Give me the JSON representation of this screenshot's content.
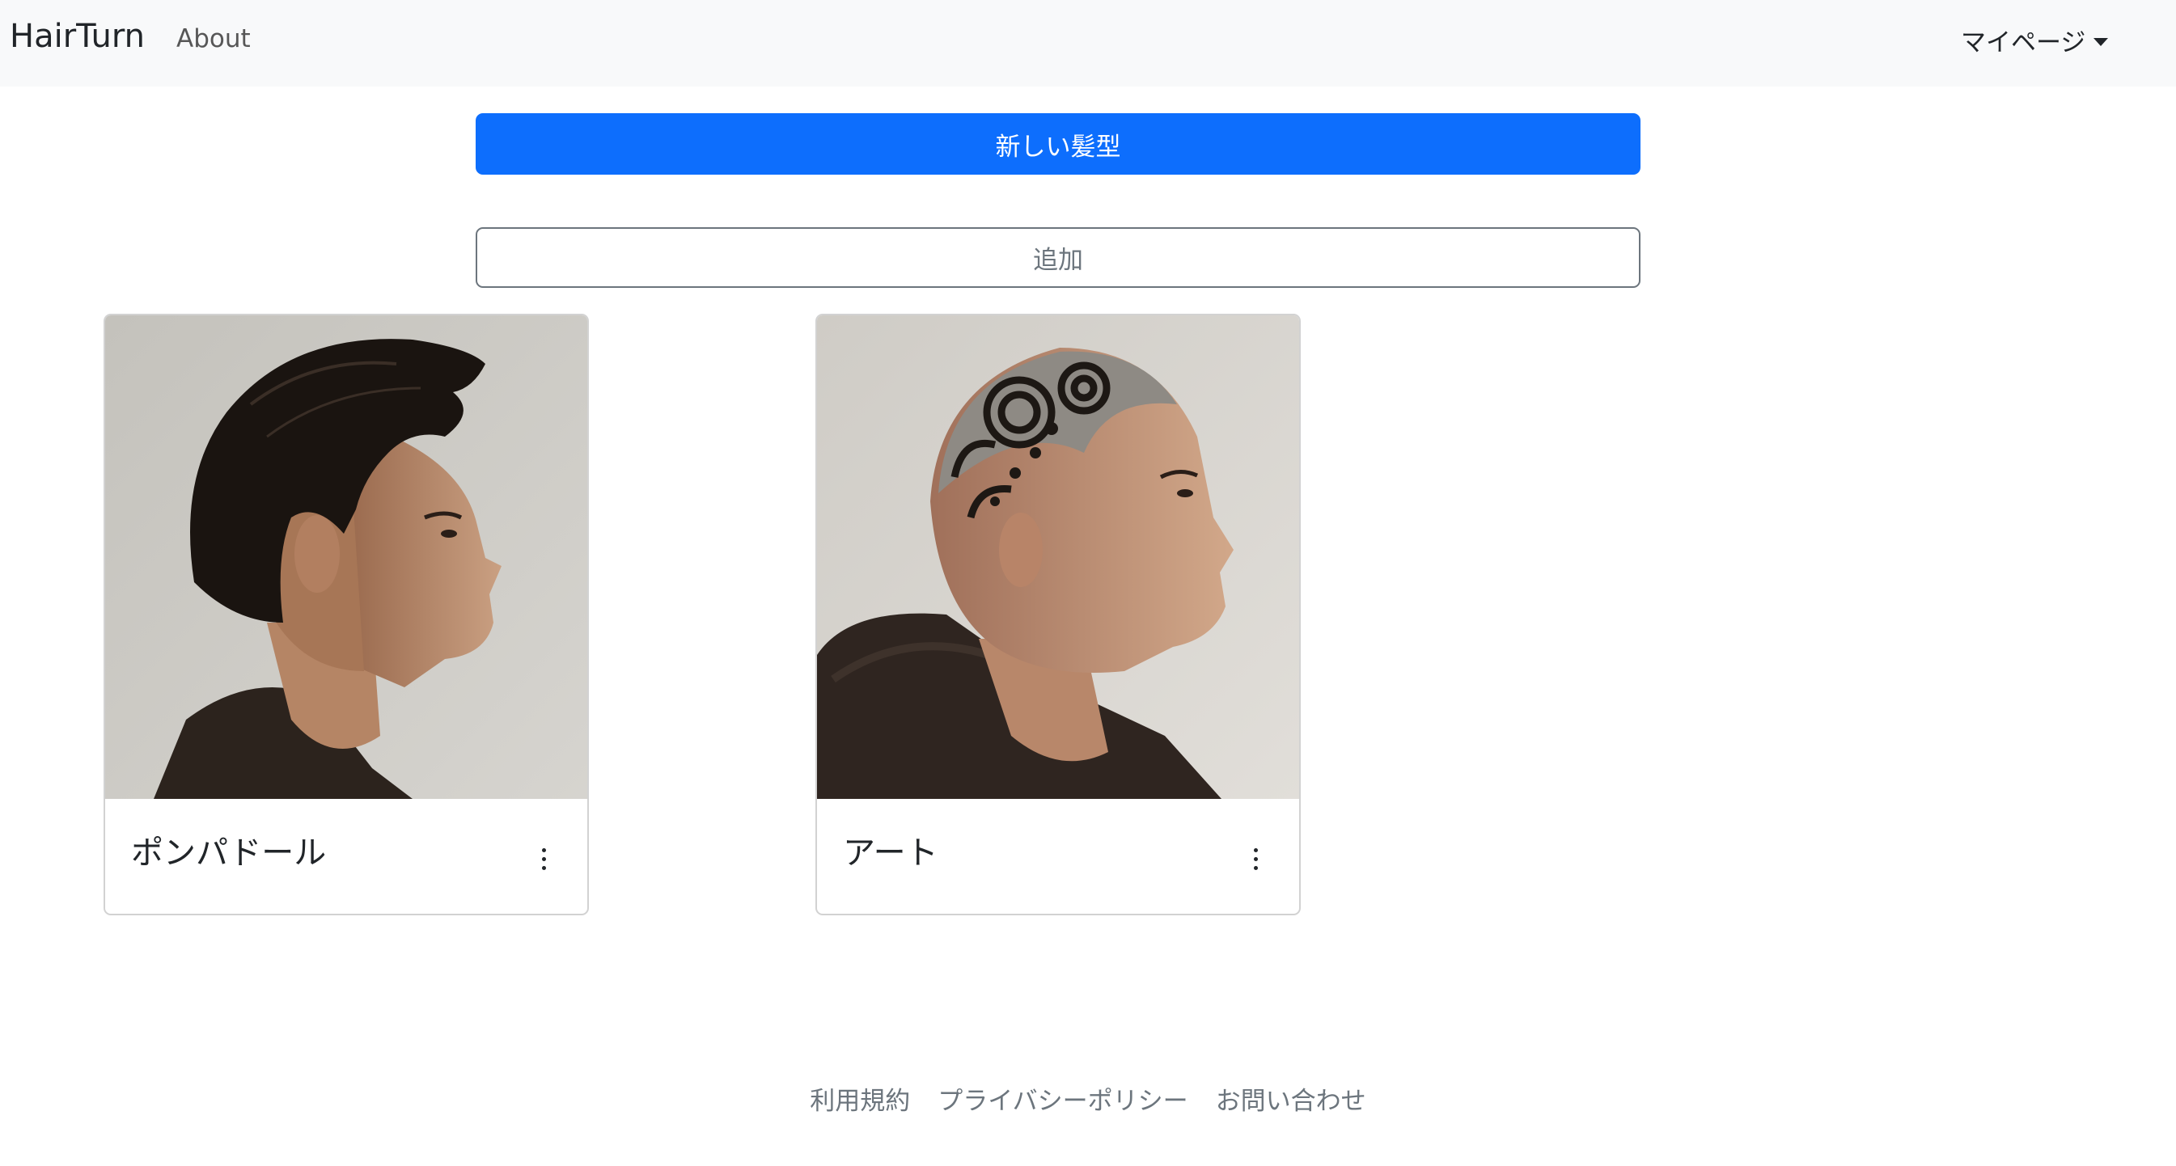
{
  "navbar": {
    "brand": "HairTurn",
    "about": "About",
    "mypage": "マイページ"
  },
  "actions": {
    "new_style": "新しい髪型",
    "add": "追加"
  },
  "cards": [
    {
      "title": "ポンパドール",
      "image": "pompadour-portrait"
    },
    {
      "title": "アート",
      "image": "hair-art-portrait"
    }
  ],
  "footer": {
    "links": [
      "利用規約",
      "プライバシーポリシー",
      "お問い合わせ"
    ]
  },
  "colors": {
    "primary": "#0d6efd",
    "navbar_bg": "#f8f9fa",
    "muted": "#6c757d"
  },
  "icons": [
    "caret-down-icon",
    "kebab-menu-icon"
  ]
}
